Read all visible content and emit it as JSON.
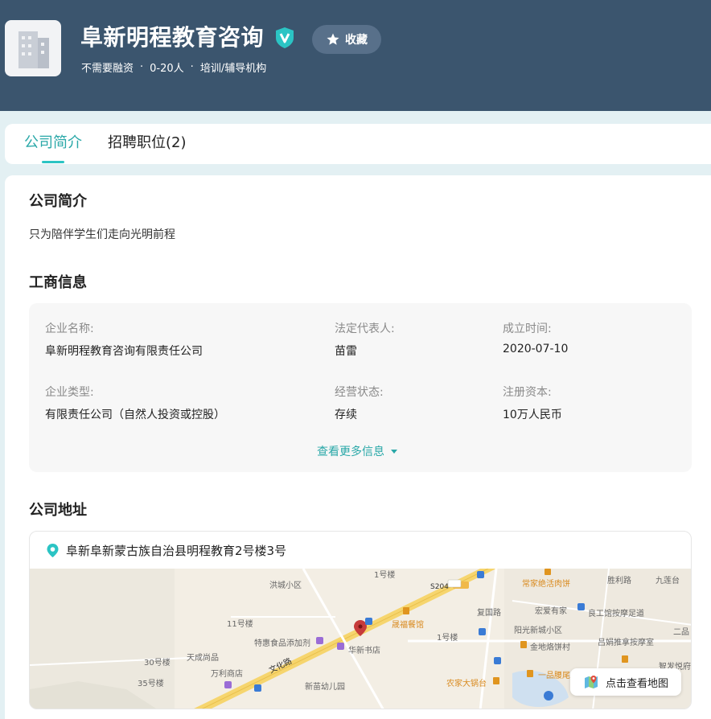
{
  "company": {
    "name": "阜新明程教育咨询",
    "tags": [
      "不需要融资",
      "0-20人",
      "培训/辅导机构"
    ],
    "favorite_label": "收藏"
  },
  "tabs": [
    {
      "label": "公司简介",
      "active": true
    },
    {
      "label": "招聘职位(2)",
      "active": false
    }
  ],
  "intro": {
    "title": "公司简介",
    "text": "只为陪伴学生们走向光明前程"
  },
  "business": {
    "title": "工商信息",
    "fields": [
      {
        "label": "企业名称:",
        "value": "阜新明程教育咨询有限责任公司"
      },
      {
        "label": "法定代表人:",
        "value": "苗雷"
      },
      {
        "label": "成立时间:",
        "value": "2020-07-10"
      },
      {
        "label": "企业类型:",
        "value": "有限责任公司（自然人投资或控股）"
      },
      {
        "label": "经营状态:",
        "value": "存续"
      },
      {
        "label": "注册资本:",
        "value": "10万人民币"
      }
    ],
    "more_label": "查看更多信息"
  },
  "address": {
    "title": "公司地址",
    "text": "阜新阜新蒙古族自治县明程教育2号楼3号",
    "map_button": "点击查看地图",
    "map_labels": [
      "洪城小区",
      "1号楼",
      "S204",
      "常家绝活肉饼",
      "胜利路",
      "九莲台",
      "11号楼",
      "晟福餐馆",
      "复国路",
      "宏爱有家",
      "良工馆按摩足道",
      "阳光新城小区",
      "二品",
      "特惠食品添加剂",
      "华新书店",
      "1号楼",
      "金地烙饼村",
      "吕娟推拿按摩室",
      "30号楼",
      "天成尚品",
      "文化路",
      "万利商店",
      "一品腰尾",
      "智发悦府",
      "35号楼",
      "新苗幼儿园",
      "农家大锅台"
    ]
  },
  "colors": {
    "header_bg": "#3b556e",
    "accent": "#2aa8a8",
    "page_bg": "#e3f0f3"
  }
}
